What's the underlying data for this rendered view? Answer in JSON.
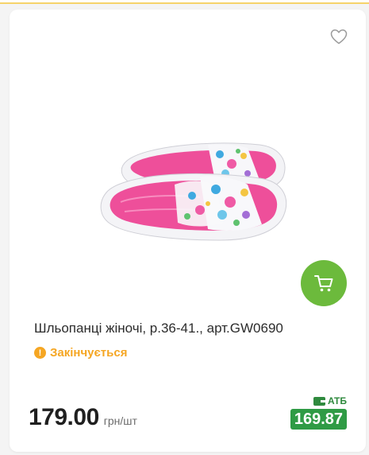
{
  "product": {
    "title": "Шльопанці жіночі, р.36-41., арт.GW0690",
    "status": "Закінчується",
    "price": "179.00",
    "unit": "грн/шт",
    "atb_label": "АТБ",
    "atb_price": "169.87"
  },
  "icons": {
    "wishlist": "heart-outline-icon",
    "cart": "shopping-cart-icon",
    "status": "exclamation-icon",
    "atb": "wallet-icon"
  },
  "colors": {
    "cart_button": "#6cba3c",
    "status": "#f5a623",
    "atb_price_bg": "#2f9b45"
  }
}
